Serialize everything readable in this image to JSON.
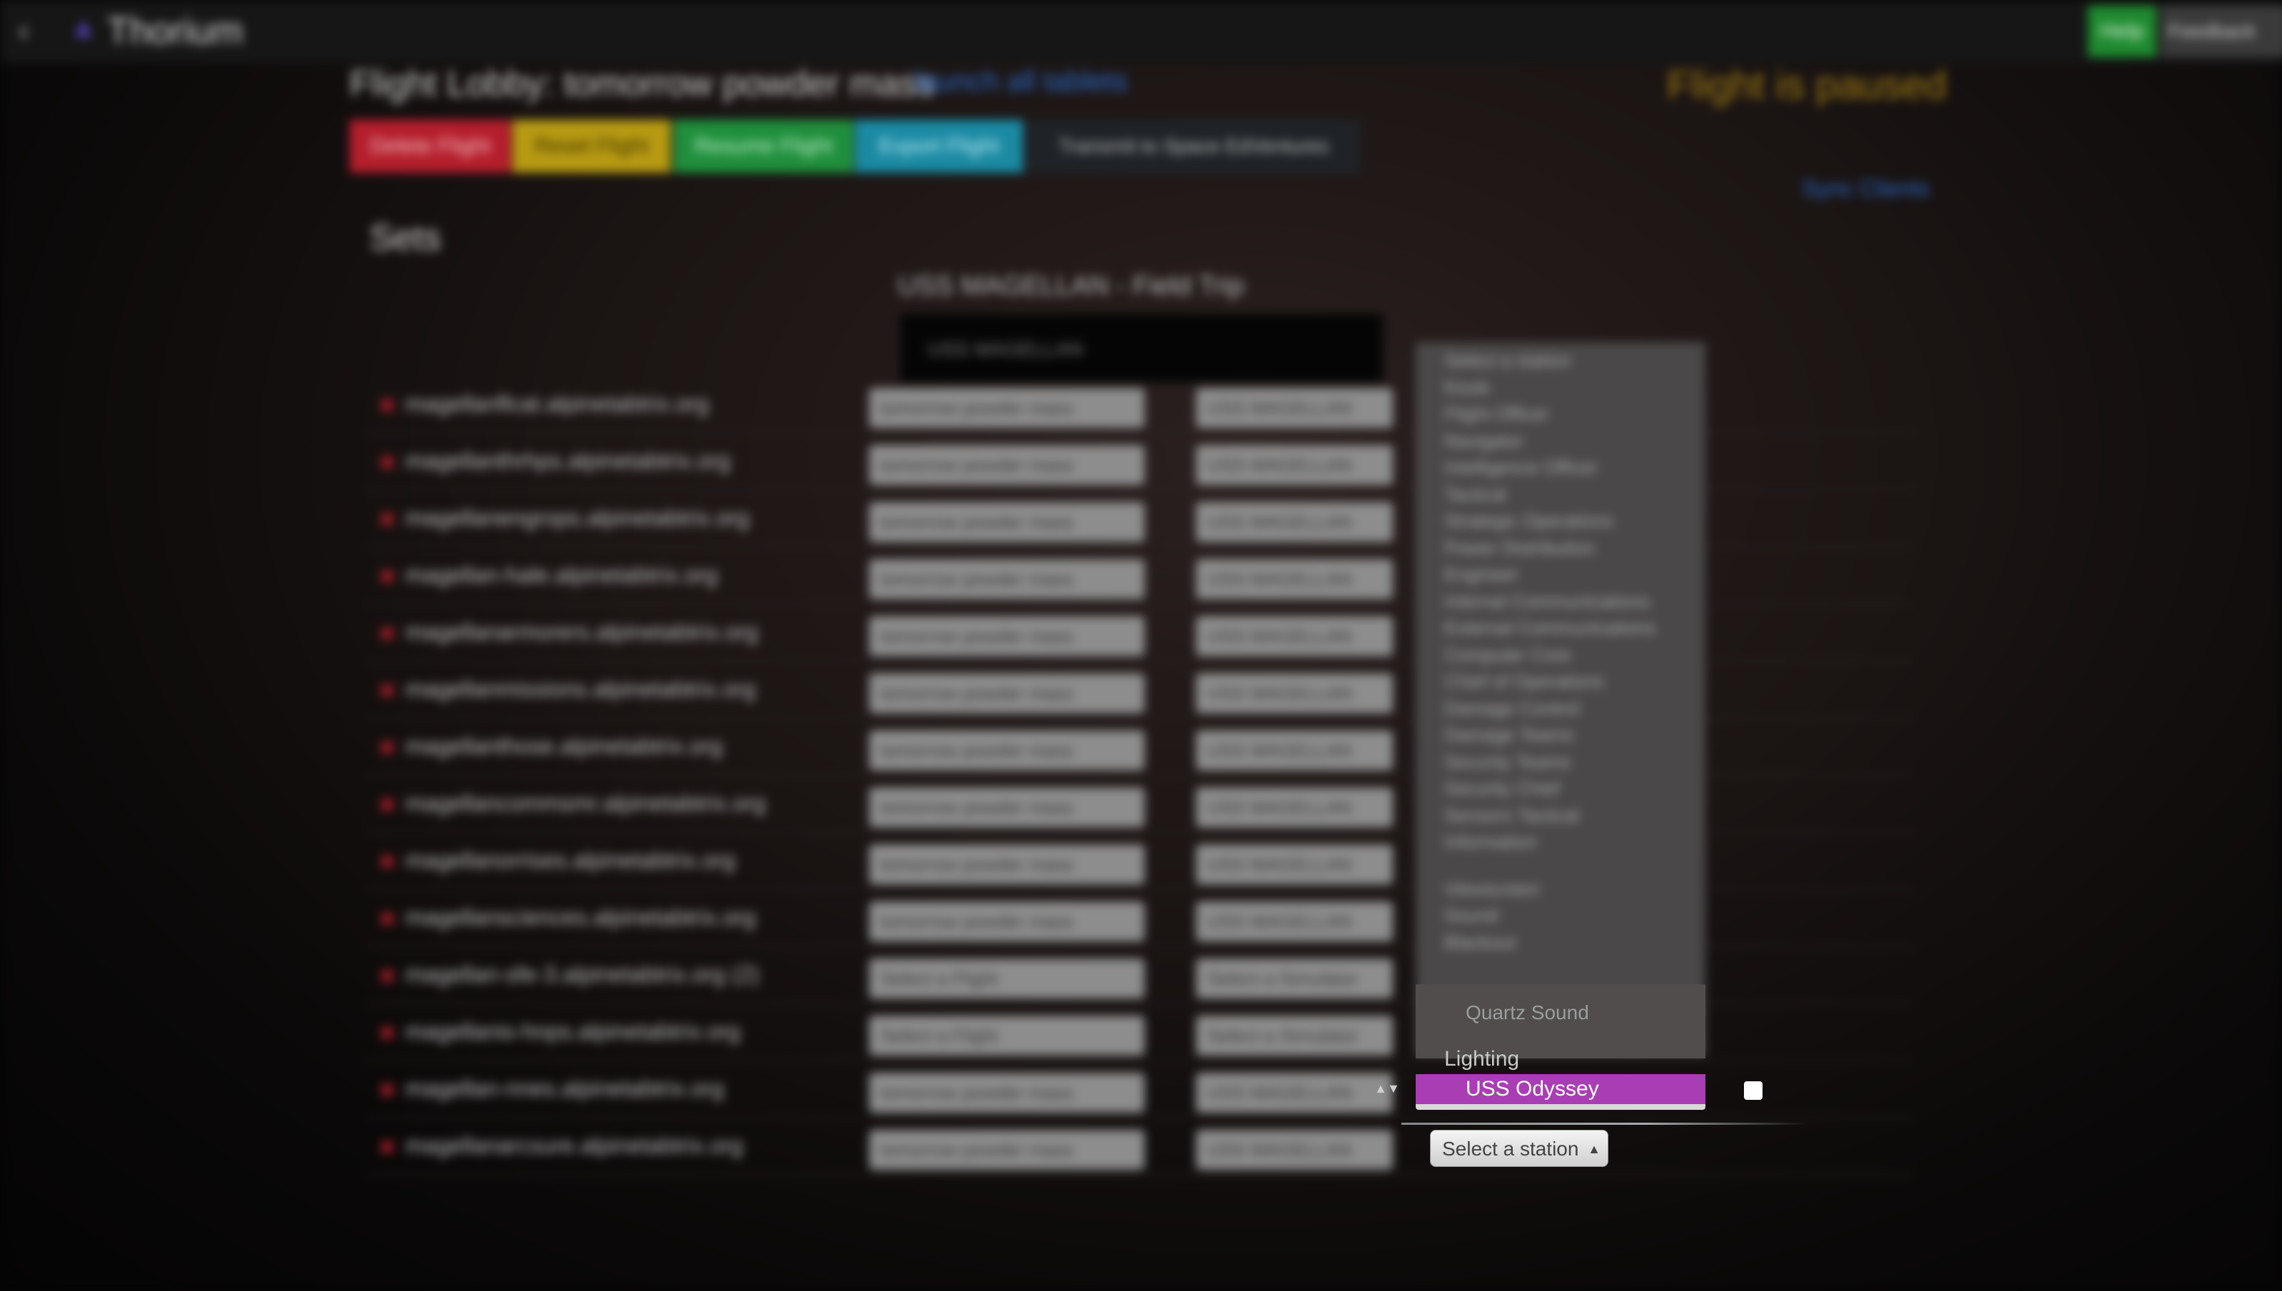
{
  "nav": {
    "back_icon": "‹",
    "logo_icon": "thorium-logo-icon",
    "title": "Thorium",
    "help_label": "Help",
    "feedback_label": "Feedback"
  },
  "header": {
    "heading": "Flight Lobby: tomorrow powder mass",
    "heading_link": "launch all tablets",
    "status": "Flight is paused"
  },
  "actions": {
    "delete": "Delete Flight",
    "reset": "Reset Flight",
    "resume": "Resume Flight",
    "export": "Export Flight",
    "transmit": "Transmit to Space EdVentures",
    "sync": "Sync Clients"
  },
  "sets": {
    "heading": "Sets",
    "simulator_title": "USS MAGELLAN - Field Trip",
    "simulator_box": "USS MAGELLAN"
  },
  "rows": [
    {
      "client": "magellanflcat.alpinetabtrix.org",
      "flight": "tomorrow powder mass",
      "simulator": "USS MAGELLAN"
    },
    {
      "client": "magellanthrhps.alpinetabtrix.org",
      "flight": "tomorrow powder mass",
      "simulator": "USS MAGELLAN"
    },
    {
      "client": "magellanengrops.alpinetabtrix.org",
      "flight": "tomorrow powder mass",
      "simulator": "USS MAGELLAN"
    },
    {
      "client": "magellan-hale.alpinetabtrix.org",
      "flight": "tomorrow powder mass",
      "simulator": "USS MAGELLAN"
    },
    {
      "client": "magellanarmorers.alpinetabtrix.org",
      "flight": "tomorrow powder mass",
      "simulator": "USS MAGELLAN"
    },
    {
      "client": "magellanmissions.alpinetabtrix.org",
      "flight": "tomorrow powder mass",
      "simulator": "USS MAGELLAN"
    },
    {
      "client": "magellanthose.alpinetabtrix.org",
      "flight": "tomorrow powder mass",
      "simulator": "USS MAGELLAN"
    },
    {
      "client": "magellancommsmr.alpinetabtrix.org",
      "flight": "tomorrow powder mass",
      "simulator": "USS MAGELLAN"
    },
    {
      "client": "magellanorrises.alpinetabtrix.org",
      "flight": "tomorrow powder mass",
      "simulator": "USS MAGELLAN"
    },
    {
      "client": "magellansciences.alpinetabtrix.org",
      "flight": "tomorrow powder mass",
      "simulator": "USS MAGELLAN"
    },
    {
      "client": "magellan-sfe-3.alpinetabtrix.org (2)",
      "flight": "Select a Flight",
      "simulator": "Select a Simulator"
    },
    {
      "client": "magellanis-hnps.alpinetabtrix.org",
      "flight": "Select a Flight",
      "simulator": "Select a Simulator"
    },
    {
      "client": "magellan-nnes.alpinetabtrix.org",
      "flight": "tomorrow powder mass",
      "simulator": "USS MAGELLAN"
    },
    {
      "client": "magellanarcsure.alpinetabtrix.org",
      "flight": "tomorrow powder mass",
      "simulator": "USS MAGELLAN"
    }
  ],
  "station_dropdown": {
    "blurred_options": [
      "Select a station",
      "Kiosk",
      "Flight Officer",
      "Navigator",
      "Intelligence Officer",
      "Tactical",
      "Strategic Operations",
      "Power Distribution",
      "Engineer",
      "Internal Communications",
      "External Communications",
      "Computer Core",
      "Chief of Operations",
      "Damage Control",
      "Damage Teams",
      "Security Teams",
      "Security Chief",
      "Sensors Tactical",
      "Information",
      "Viewscreen",
      "Sound",
      "Blackout"
    ],
    "visible_option": "Quartz Sound",
    "group_label": "Lighting",
    "highlighted_option": "USS Odyssey",
    "select_placeholder": "Select a station",
    "highlight_color": "#a93db4"
  }
}
